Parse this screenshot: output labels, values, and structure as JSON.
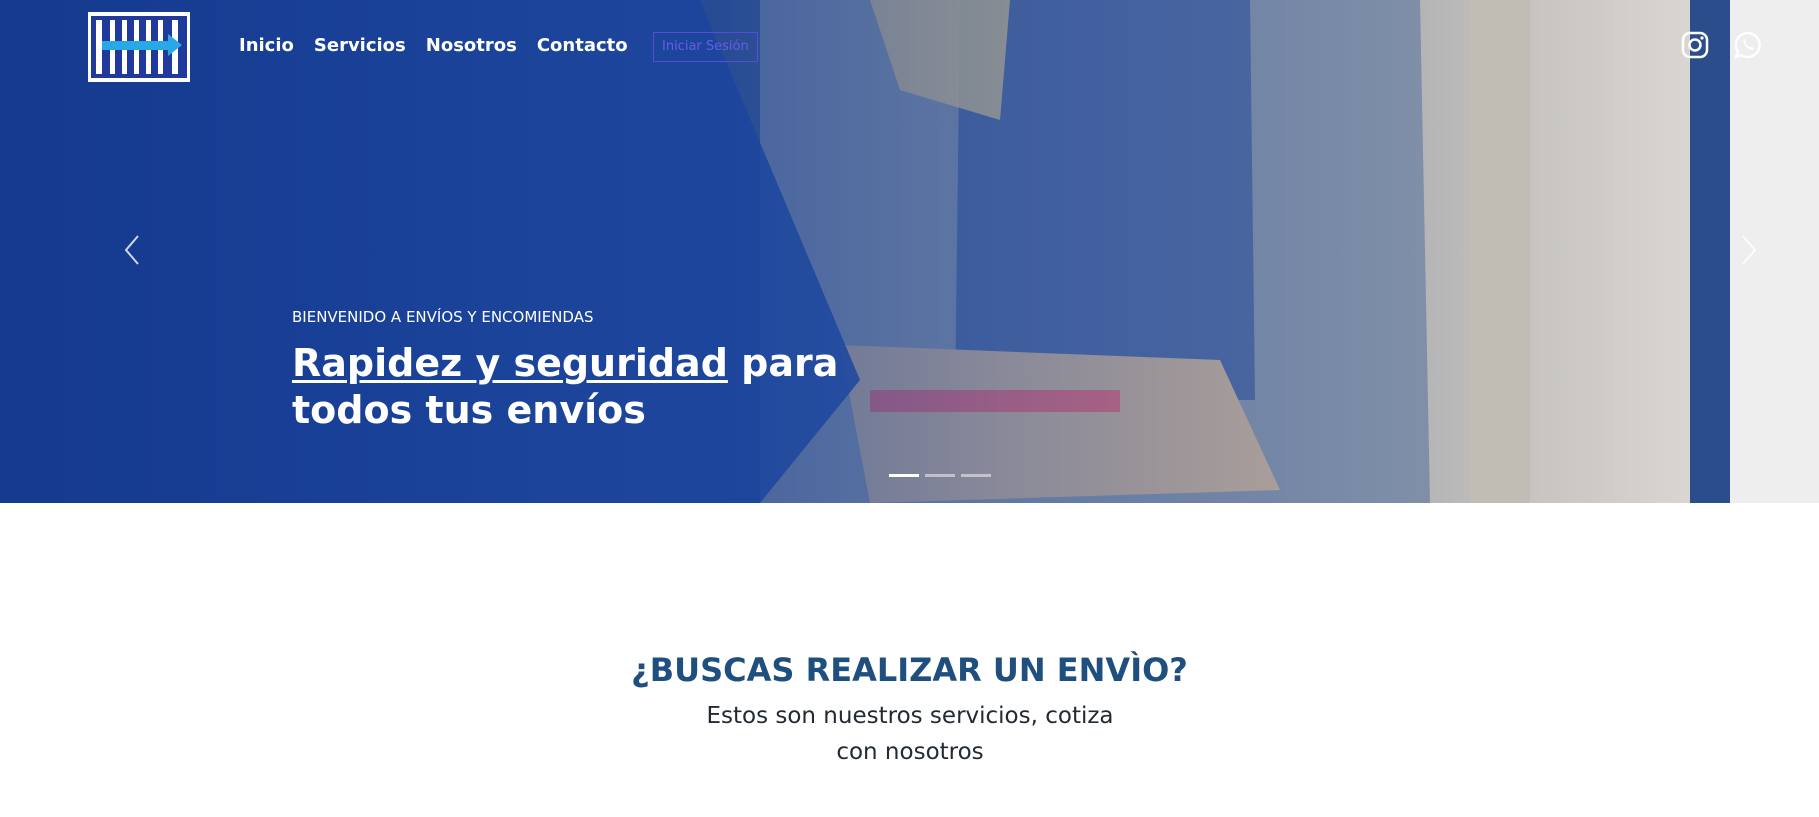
{
  "brand": {
    "logo_alt": "DELIVEX"
  },
  "nav": {
    "links": [
      "Inicio",
      "Servicios",
      "Nosotros",
      "Contacto"
    ],
    "login_label": "Iniciar Sesión",
    "social": [
      "instagram-icon",
      "whatsapp-icon"
    ]
  },
  "hero": {
    "kicker": "BIENVENIDO A ENVÍOS Y ENCOMIENDAS",
    "title_highlight": "Rapidez y seguridad",
    "title_rest_1": " para",
    "title_rest_2": "todos tus envíos",
    "slides": 3,
    "active_slide": 0
  },
  "section": {
    "title": "¿BUSCAS REALIZAR UN ENVÌO?",
    "subtitle": "Estos son nuestros servicios, cotiza con nosotros"
  },
  "colors": {
    "nav_text": "#ffffff",
    "login_border": "#5a4ad8",
    "section_title": "#1f4f7f",
    "hero_overlay": "#1c3f8f"
  }
}
